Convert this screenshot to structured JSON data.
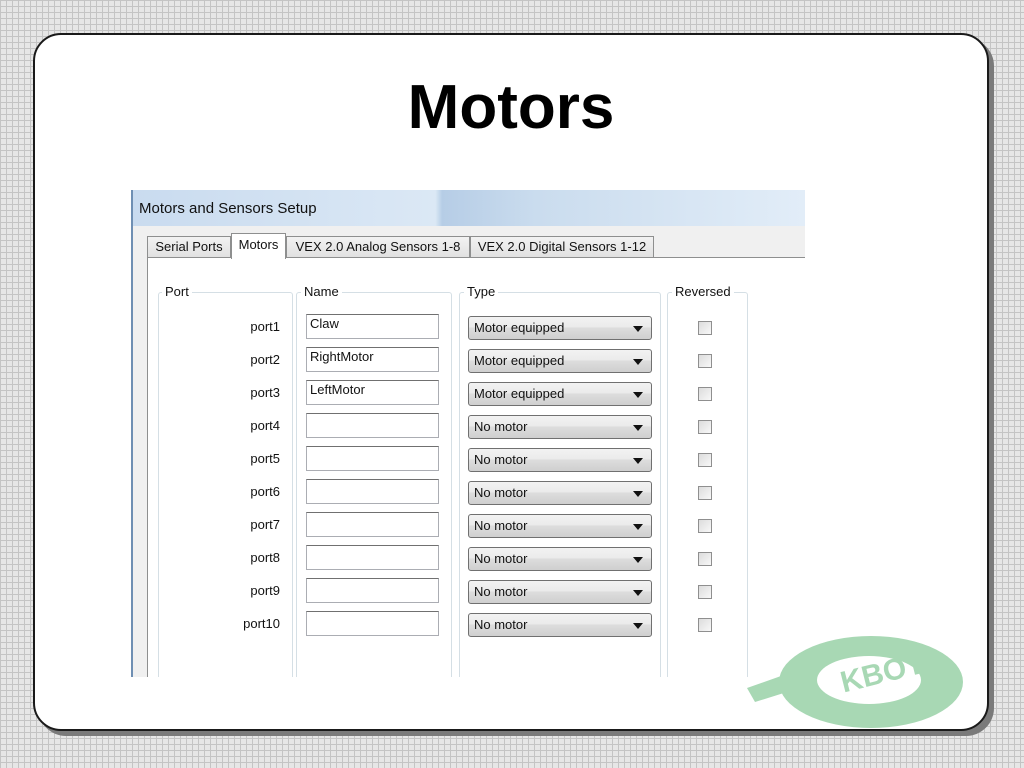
{
  "slide": {
    "title": "Motors"
  },
  "dialog": {
    "title": "Motors and Sensors Setup",
    "tabs": [
      {
        "label": "Serial Ports",
        "active": false
      },
      {
        "label": "Motors",
        "active": true
      },
      {
        "label": "VEX 2.0 Analog Sensors 1-8",
        "active": false
      },
      {
        "label": "VEX 2.0 Digital Sensors 1-12",
        "active": false
      }
    ],
    "columns": {
      "port": "Port",
      "name": "Name",
      "type": "Type",
      "reversed": "Reversed"
    },
    "rows": [
      {
        "port": "port1",
        "name": "Claw",
        "type": "Motor equipped",
        "reversed": false
      },
      {
        "port": "port2",
        "name": "RightMotor",
        "type": "Motor equipped",
        "reversed": false
      },
      {
        "port": "port3",
        "name": "LeftMotor",
        "type": "Motor equipped",
        "reversed": false
      },
      {
        "port": "port4",
        "name": "",
        "type": "No motor",
        "reversed": false
      },
      {
        "port": "port5",
        "name": "",
        "type": "No motor",
        "reversed": false
      },
      {
        "port": "port6",
        "name": "",
        "type": "No motor",
        "reversed": false
      },
      {
        "port": "port7",
        "name": "",
        "type": "No motor",
        "reversed": false
      },
      {
        "port": "port8",
        "name": "",
        "type": "No motor",
        "reversed": false
      },
      {
        "port": "port9",
        "name": "",
        "type": "No motor",
        "reversed": false
      },
      {
        "port": "port10",
        "name": "",
        "type": "No motor",
        "reversed": false
      }
    ]
  },
  "logo": {
    "text": "KBOT",
    "color": "#a8d8b4"
  }
}
